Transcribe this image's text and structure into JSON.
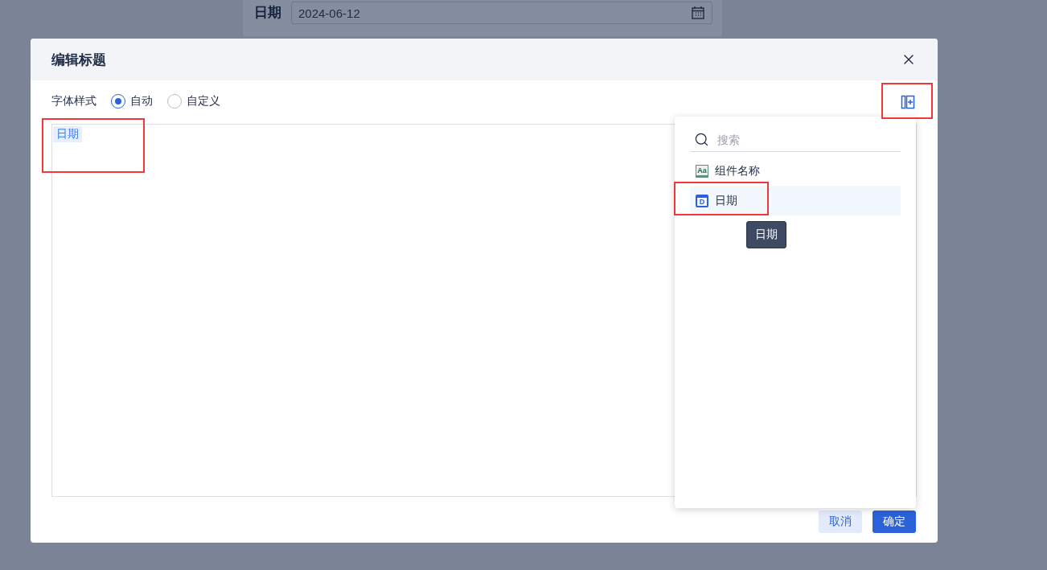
{
  "background_form": {
    "label": "日期",
    "date_value": "2024-06-12"
  },
  "dialog": {
    "title": "编辑标题",
    "font_style": {
      "label": "字体样式",
      "options": [
        {
          "label": "自动",
          "selected": true
        },
        {
          "label": "自定义",
          "selected": false
        }
      ]
    },
    "add_field_button": {
      "highlighted": true
    },
    "editor": {
      "tokens": [
        {
          "text": "日期",
          "highlighted": true
        }
      ]
    },
    "field_panel": {
      "search": {
        "placeholder": "搜索"
      },
      "items": [
        {
          "kind": "text",
          "badge": "Aa",
          "label": "组件名称",
          "hovered": false,
          "highlighted": false
        },
        {
          "kind": "date",
          "badge": "D",
          "label": "日期",
          "hovered": true,
          "highlighted": true,
          "tooltip": "日期"
        }
      ]
    },
    "buttons": [
      {
        "label": "取消",
        "kind": "secondary"
      },
      {
        "label": "确定",
        "kind": "primary"
      }
    ]
  }
}
